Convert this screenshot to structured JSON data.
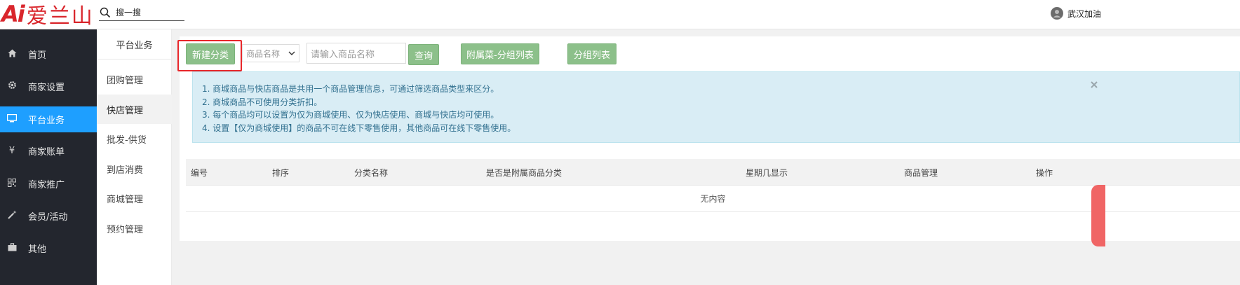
{
  "header": {
    "logo_ai": "Ai",
    "logo_cn": "爱兰山",
    "search_label": "搜一搜",
    "user_name": "武汉加油"
  },
  "sidebar": {
    "items": [
      {
        "label": "首页",
        "icon": "home-icon"
      },
      {
        "label": "商家设置",
        "icon": "gear-icon"
      },
      {
        "label": "平台业务",
        "icon": "monitor-icon",
        "active": true
      },
      {
        "label": "商家账单",
        "icon": "yen-icon"
      },
      {
        "label": "商家推广",
        "icon": "qrcode-icon"
      },
      {
        "label": "会员/活动",
        "icon": "magic-wand-icon"
      },
      {
        "label": "其他",
        "icon": "briefcase-icon"
      }
    ]
  },
  "subnav": {
    "title": "平台业务",
    "items": [
      {
        "label": "团购管理"
      },
      {
        "label": "快店管理",
        "active": true
      },
      {
        "label": "批发-供货"
      },
      {
        "label": "到店消费"
      },
      {
        "label": "商城管理"
      },
      {
        "label": "预约管理"
      }
    ]
  },
  "toolbar": {
    "new_category": "新建分类",
    "select_value": "商品名称",
    "input_placeholder": "请输入商品名称",
    "query": "查询",
    "attached_group_list": "附属菜-分组列表",
    "group_list": "分组列表"
  },
  "notice": {
    "lines": [
      "1. 商城商品与快店商品是共用一个商品管理信息，可通过筛选商品类型来区分。",
      "2. 商城商品不可使用分类折扣。",
      "3. 每个商品均可以设置为仅为商城使用、仅为快店使用、商城与快店均可使用。",
      "4. 设置【仅为商城使用】的商品不可在线下零售使用，其他商品可在线下零售使用。"
    ]
  },
  "table": {
    "headers": [
      "编号",
      "排序",
      "分类名称",
      "是否是附属商品分类",
      "星期几显示",
      "商品管理",
      "操作"
    ],
    "empty_text": "无内容"
  },
  "colors": {
    "sidebar_bg": "#23262e",
    "sidebar_active": "#1e9fff",
    "button_green": "#8cc08a",
    "highlight_red": "#e8262a",
    "notice_bg": "#d9edf5",
    "logo_red": "#d9262c"
  }
}
